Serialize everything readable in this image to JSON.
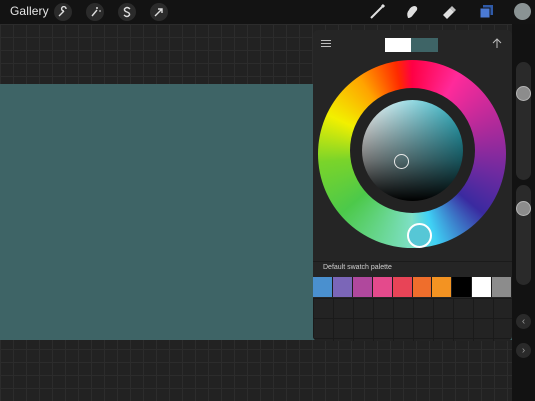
{
  "toolbar": {
    "gallery_label": "Gallery",
    "tools_left": [
      "wrench-icon",
      "magic-wand-icon",
      "selection-s-icon",
      "transform-arrow-icon"
    ],
    "tools_right": [
      "brush-icon",
      "smudge-icon",
      "eraser-icon",
      "layers-icon"
    ],
    "active_color": "#8a9394"
  },
  "canvas": {
    "artwork_color": "#3e6466"
  },
  "color_panel": {
    "previous_color": "#ffffff",
    "current_color": "#3e6466",
    "palette_label": "Default swatch palette",
    "swatches": [
      "#4a90cf",
      "#7b66b8",
      "#b0489d",
      "#e44a8c",
      "#e84457",
      "#ef6e2c",
      "#f39322",
      "#000000",
      "#ffffff",
      "#8c8c8c"
    ]
  },
  "sidebar": {
    "undo_icon": "chevron-left-icon",
    "redo_icon": "chevron-right-icon"
  }
}
